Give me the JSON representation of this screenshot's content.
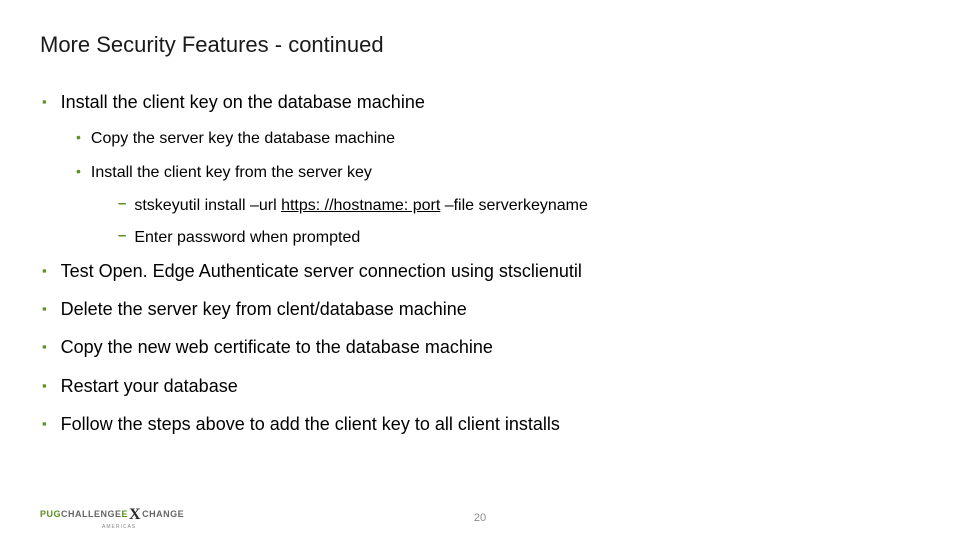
{
  "title": "More Security Features - continued",
  "items": [
    {
      "text": "Install the client key on the database machine",
      "sub": [
        {
          "text": "Copy the server key the database machine"
        },
        {
          "text": "Install the client key from the server key",
          "sub": [
            {
              "pre": "stskeyutil install –url ",
              "link": "https: //hostname: port",
              "post": " –file serverkeyname"
            },
            {
              "pre": "Enter password when prompted",
              "link": "",
              "post": ""
            }
          ]
        }
      ]
    },
    {
      "text": "Test Open. Edge Authenticate server connection using stsclienutil"
    },
    {
      "text": "Delete the server key from clent/database machine"
    },
    {
      "text": "Copy the new web certificate to the database machine"
    },
    {
      "text": "Restart your database"
    },
    {
      "text": "Follow the steps above to add the client key to all client installs"
    }
  ],
  "logo": {
    "p1": "PUG",
    "p2": "CHALLENGE",
    "p3": "E",
    "p4": "CHANGE",
    "sub": "AMERICAS"
  },
  "pageNumber": "20"
}
